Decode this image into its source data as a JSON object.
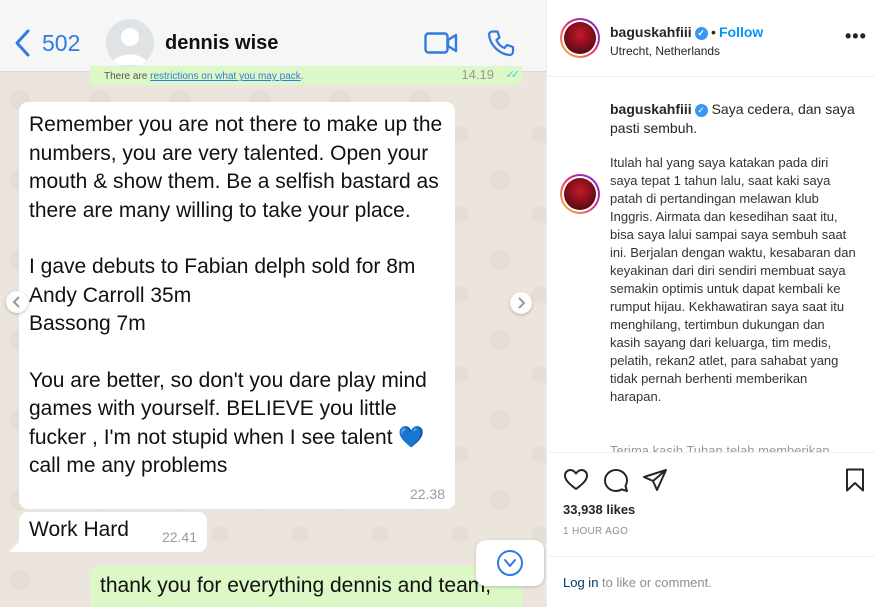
{
  "whatsapp": {
    "back_count": "502",
    "contact_name": "dennis wise",
    "notice": {
      "prefix": "There are ",
      "link": "restrictions on what you may pack",
      "suffix": ".",
      "time": "14.19"
    },
    "message1": {
      "paragraphs": [
        "Remember you are not there to make up the numbers, you are very talented. Open your mouth & show them.  Be a selfish bastard as there are many willing to take your place.",
        "I gave debuts to Fabian delph sold for 8m\nAndy Carroll 35m\nBassong 7m",
        "You are better,  so don't you dare play mind games with yourself.  BELIEVE you little fucker , I'm not stupid when I see talent 💙 call me any problems"
      ],
      "time": "22.38"
    },
    "message2": {
      "text": "Work Hard",
      "time": "22.41"
    },
    "message3": {
      "text": "thank you for everything dennis and team,"
    }
  },
  "instagram": {
    "username": "baguskahfiii",
    "verified_mark": "✓",
    "dot": "•",
    "follow_label": "Follow",
    "location": "Utrecht, Netherlands",
    "more_label": "•••",
    "caption_head": "Saya cedera, dan saya pasti sembuh.",
    "caption_body": "Itulah hal yang saya katakan pada diri saya tepat 1 tahun lalu, saat kaki saya patah di pertandingan melawan klub Inggris. Airmata dan kesedihan saat itu, bisa saya lalui sampai saya sembuh saat ini. Berjalan dengan waktu, kesabaran dan keyakinan dari diri sendiri membuat saya semakin optimis untuk dapat kembali ke rumput hijau. Kekhawatiran saya saat itu menghilang, tertimbun dukungan dan kasih sayang dari keluarga, tim medis, pelatih, rekan2 atlet, para sahabat yang tidak pernah berhenti memberikan harapan.",
    "caption_cut": "Terima kasih Tuhan telah memberikan",
    "likes": "33,938 likes",
    "posted_ago": "1 HOUR AGO",
    "login_link": "Log in",
    "login_suffix": " to like or comment."
  },
  "colors": {
    "wa_accent": "#2f7be0",
    "wa_outgoing": "#dcf8c6",
    "wa_background": "#ece5dd",
    "ig_follow": "#0095f6",
    "ig_verified": "#3897f0"
  }
}
